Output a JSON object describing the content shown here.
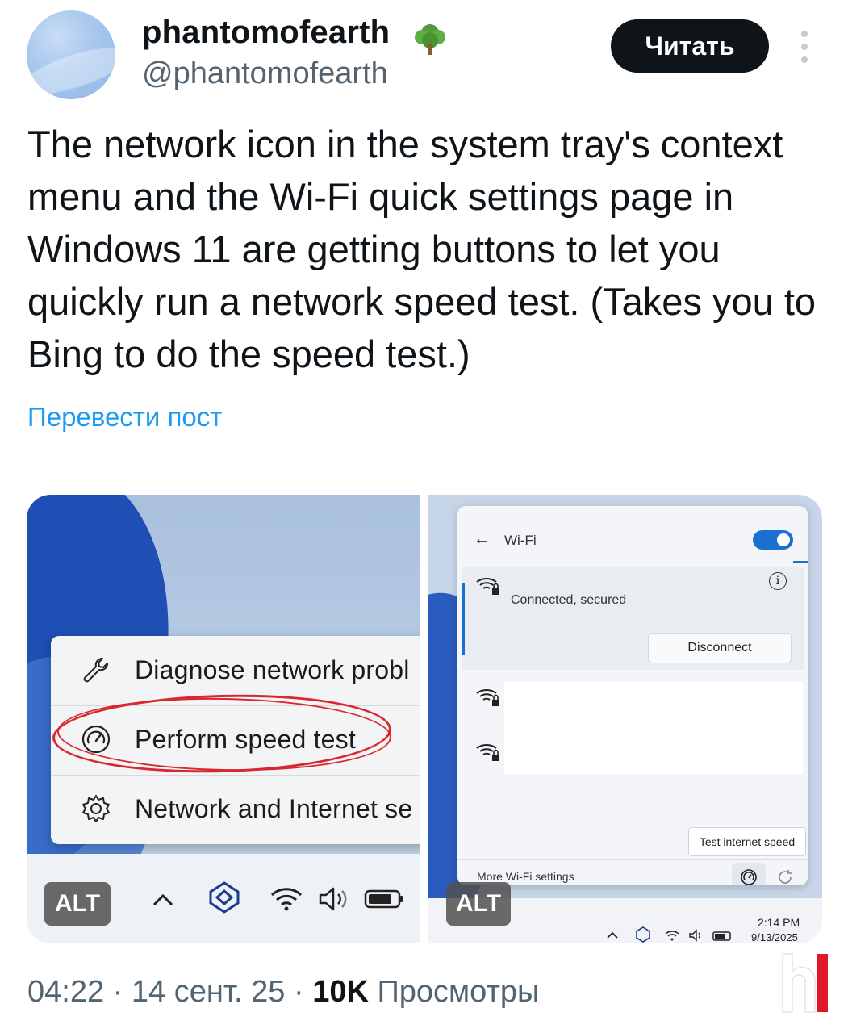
{
  "author": {
    "display_name": "phantomofearth",
    "handle": "@phantomofearth",
    "badge_icon": "deciduous-tree-emoji"
  },
  "actions": {
    "follow_label": "Читать",
    "more_icon": "vertical-ellipsis-icon"
  },
  "post": {
    "text": "The network icon in the system tray's context menu and the Wi-Fi quick settings page in Windows 11 are getting buttons to let you quickly run a network speed test. (Takes you to Bing to do the speed test.)",
    "translate_label": "Перевести пост"
  },
  "media": {
    "left": {
      "menu_items": [
        {
          "label": "Diagnose network probl",
          "icon": "wrench-icon"
        },
        {
          "label": "Perform speed test",
          "icon": "speedometer-icon",
          "highlighted": true
        },
        {
          "label": "Network and Internet se",
          "icon": "gear-icon"
        }
      ],
      "alt_label": "ALT",
      "tray_icons": [
        "chevron-up-icon",
        "copilot-icon",
        "wifi-icon",
        "volume-icon",
        "battery-icon"
      ],
      "highlight_color": "#d9272e"
    },
    "right": {
      "panel_title": "Wi-Fi",
      "back_icon": "←",
      "connected_status": "Connected, secured",
      "info_icon": "i",
      "disconnect_label": "Disconnect",
      "tooltip": "Test internet speed",
      "more_settings": "More Wi-Fi settings",
      "alt_label": "ALT",
      "time": "2:14 PM",
      "date": "9/13/2025",
      "accent_color": "#1a6fd1"
    }
  },
  "meta": {
    "time": "04:22",
    "sep1": "·",
    "date": "14 сент. 25",
    "sep2": "·",
    "views_count": "10K",
    "views_label": "Просмотры"
  },
  "watermark": {
    "colors": [
      "#ffffff",
      "#e0162b"
    ]
  }
}
